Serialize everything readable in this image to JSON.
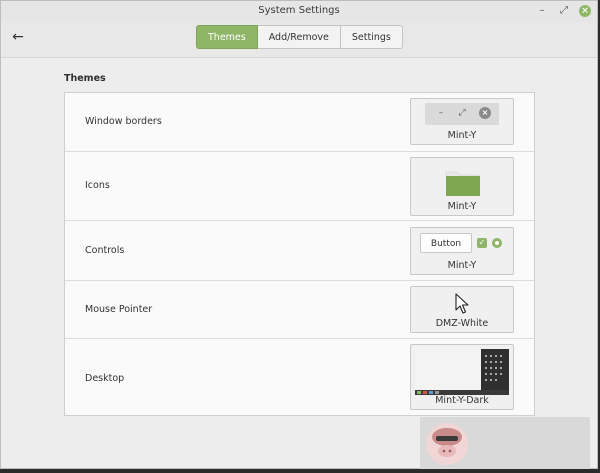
{
  "window": {
    "title": "System Settings"
  },
  "titlebar": {
    "min_glyph": "–",
    "max_glyph": "⤢",
    "close_glyph": "×"
  },
  "header": {
    "back_glyph": "←",
    "tabs": [
      {
        "label": "Themes",
        "active": true
      },
      {
        "label": "Add/Remove",
        "active": false
      },
      {
        "label": "Settings",
        "active": false
      }
    ]
  },
  "themes": {
    "section_title": "Themes",
    "rows": [
      {
        "label": "Window borders",
        "value": "Mint-Y",
        "icon": "window-buttons-preview-icon"
      },
      {
        "label": "Icons",
        "value": "Mint-Y",
        "icon": "folder-icon"
      },
      {
        "label": "Controls",
        "value": "Mint-Y",
        "icon": "controls-preview-icon"
      },
      {
        "label": "Mouse Pointer",
        "value": "DMZ-White",
        "icon": "mouse-pointer-icon"
      },
      {
        "label": "Desktop",
        "value": "Mint-Y-Dark",
        "icon": "desktop-thumbnail-icon"
      }
    ],
    "controls_preview": {
      "button_label": "Button",
      "check_glyph": "✓"
    },
    "window_preview": {
      "min_glyph": "–",
      "max_glyph": "⤢",
      "close_glyph": "×"
    }
  },
  "colors": {
    "accent": "#8fb567",
    "window_bg": "#ededed",
    "panel_bg": "#fafafa",
    "folder": "#7fa650"
  }
}
